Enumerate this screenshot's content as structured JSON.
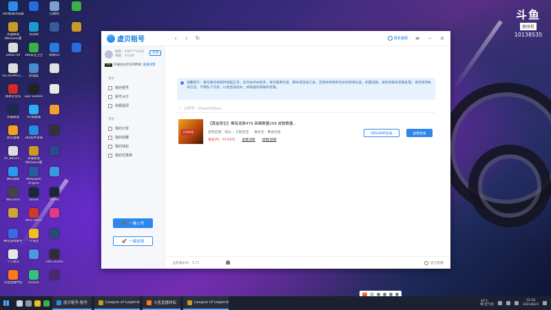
{
  "desktop": {
    "icons": [
      {
        "label": "360极速浏览器",
        "color": "#2e8bea"
      },
      {
        "label": "英雄联盟 WeGame版",
        "color": "#c79a2a"
      },
      {
        "label": "beta5.49",
        "color": "#ddd"
      },
      {
        "label": "la13439911...",
        "color": "#ddd"
      },
      {
        "label": "网易云音乐",
        "color": "#d52a2a"
      },
      {
        "label": "英雄联盟",
        "color": "#1e2a4a"
      },
      {
        "label": "虎牙直播",
        "color": "#f4a020"
      },
      {
        "label": "tcl_b6521...",
        "color": "#ddd"
      },
      {
        "label": "腾讯视频",
        "color": "#2a9af0"
      },
      {
        "label": "WeGame",
        "color": "#444"
      },
      {
        "label": "",
        "color": "#cfa23a"
      },
      {
        "label": "腾讯游戏助手",
        "color": "#3a6ae0"
      },
      {
        "label": "个人简历",
        "color": "#e8e8e8"
      },
      {
        "label": "斗鱼直播伴侣",
        "color": "#ff7a1a"
      },
      {
        "label": "",
        "color": "#2a6ae0"
      },
      {
        "label": "优化网",
        "color": "#1a9ad0"
      },
      {
        "label": "360安全卫士",
        "color": "#3ab04a"
      },
      {
        "label": "此电脑",
        "color": "#4a8ad0"
      },
      {
        "label": "Epic Games",
        "color": "#222"
      },
      {
        "label": "UU加速器",
        "color": "#2ab0f0"
      },
      {
        "label": "360软件管家",
        "color": "#2a8ae0"
      },
      {
        "label": "英雄联盟 WeGame版",
        "color": "#c79a2a"
      },
      {
        "label": "Wallpaper Engine",
        "color": "#2a5aa0"
      },
      {
        "label": "Steam",
        "color": "#1b2838"
      },
      {
        "label": "WPS Office",
        "color": "#d03a2a"
      },
      {
        "label": "YY语音",
        "color": "#f0c020"
      },
      {
        "label": "",
        "color": "#4a9ae0"
      },
      {
        "label": "QQ音乐",
        "color": "#31c27c"
      },
      {
        "label": "回收站",
        "color": "#7aa0d0"
      },
      {
        "label": "",
        "color": "#3a5a9a"
      },
      {
        "label": "网易UU",
        "color": "#2a7ae0"
      },
      {
        "label": "",
        "color": "#e0e0e0"
      },
      {
        "label": "",
        "color": "#e8e8e8"
      },
      {
        "label": "",
        "color": "#f0a030"
      },
      {
        "label": "",
        "color": "#333"
      },
      {
        "label": "",
        "color": "#2a4a8a"
      },
      {
        "label": "",
        "color": "#3a9ae0"
      },
      {
        "label": "Steam",
        "color": "#1b2838"
      },
      {
        "label": "",
        "color": "#e03a8a"
      },
      {
        "label": "",
        "color": "#2a4a7a"
      },
      {
        "label": "OBS Studio",
        "color": "#302e31"
      },
      {
        "label": "",
        "color": "#4a2a6a"
      },
      {
        "label": "",
        "color": "#3ab04a"
      },
      {
        "label": "",
        "color": "#c79a2a"
      },
      {
        "label": "",
        "color": "#2a6ae0"
      }
    ]
  },
  "stream_logo": {
    "brand": "斗鱼",
    "room_label": "房间号",
    "room_number": "10138535"
  },
  "window": {
    "logo_text": "虚贝租号",
    "toolbar": {
      "back": "‹",
      "forward": "›",
      "refresh": "↻",
      "service_label": "联系客服",
      "menu": "≡",
      "minimize": "–",
      "close": "×"
    },
    "profile": {
      "line1": "昵称：176****2435",
      "line2": "余额：￥0.00",
      "charge": "充值"
    },
    "vip": {
      "tag": "VIP",
      "text": "开通会员享多项特权",
      "link": "查看详情"
    },
    "sidebar": {
      "section1": "租号",
      "items1": [
        "我的租号",
        "租号大厅",
        "余额提现"
      ],
      "section2": "其他",
      "items2": [
        "我的订单",
        "我的收藏",
        "我的钱包",
        "我的优惠券"
      ],
      "btn_primary": "一键上号",
      "btn_secondary": "一键加速"
    },
    "notice": "温馨提示：租号期间请保持电脑正常，且勿关闭本程序，请勿使用外挂、脚本等违规工具，否则将导致封号并扣除保证金。如遇问题，请及时联系客服处理；请勿修改账号信息、不要私下交易，以免造成损失。如有疑问请联系客服。",
    "search": {
      "icon": "⌕",
      "placeholder": "订单号：15yazmf0wvx"
    },
    "card": {
      "thumb_tag": "英雄联盟",
      "title": "【黄金段位】稀有皮肤479 英雄数量156 皮肤数量...",
      "meta": [
        "游戏区服：电信一 艾欧尼亚",
        "角色名：黄金玩家"
      ],
      "price": "租金/时：¥4.00元",
      "link1": "查看详情",
      "link2": "续租/退租",
      "btn_wegame": "WEGAME登录",
      "btn_view": "查看登录"
    },
    "status": {
      "left": "当前版本号：3.71",
      "right": "官方客服"
    }
  },
  "taskbar": {
    "tasks": [
      {
        "label": "虚贝租号-租号",
        "color": "#2e8bea"
      },
      {
        "label": "League of Legends",
        "color": "#c79a2a"
      },
      {
        "label": "斗鱼直播伴侣",
        "color": "#ff7a1a"
      },
      {
        "label": "League of Legends -...",
        "color": "#c79a2a"
      }
    ],
    "weather": {
      "temp": "34°C",
      "desc": "晴 空气优"
    },
    "time": "22:18",
    "date": "2021/8/23",
    "ime": "中"
  }
}
